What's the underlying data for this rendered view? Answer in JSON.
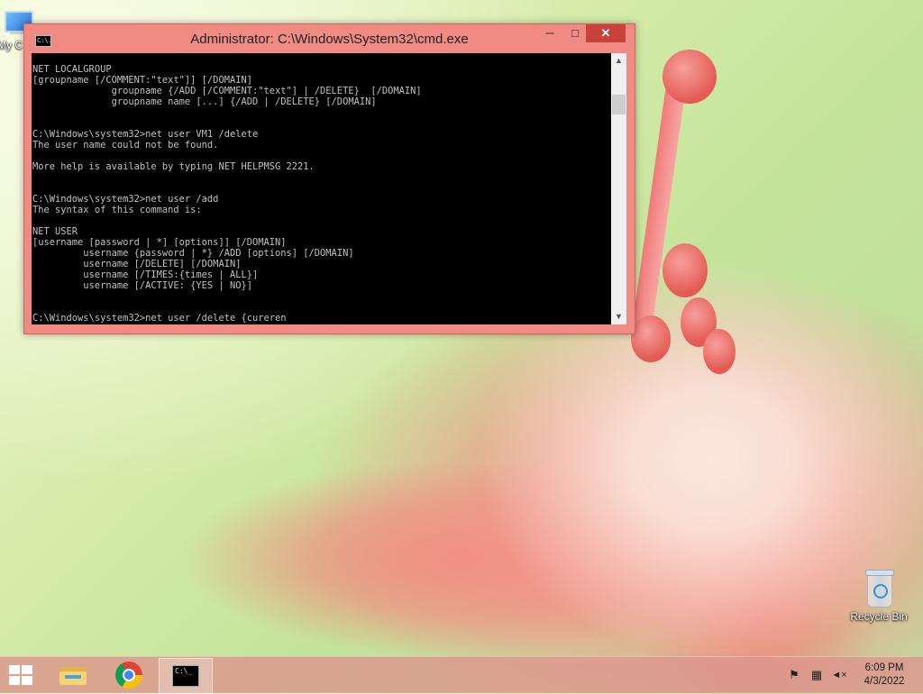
{
  "desktop": {
    "icons": [
      {
        "label": "My C"
      },
      {
        "label": "Recycle Bin"
      }
    ]
  },
  "window": {
    "title": "Administrator: C:\\Windows\\System32\\cmd.exe",
    "title_icon_text": "C:\\.",
    "minimize": "─",
    "maximize": "□",
    "close": "✕",
    "console_lines": [
      "NET LOCALGROUP",
      "[groupname [/COMMENT:\"text\"]] [/DOMAIN]",
      "              groupname {/ADD [/COMMENT:\"text\"] | /DELETE}  [/DOMAIN]",
      "              groupname name [...] {/ADD | /DELETE} [/DOMAIN]",
      "",
      "",
      "C:\\Windows\\system32>net user VM1 /delete",
      "The user name could not be found.",
      "",
      "More help is available by typing NET HELPMSG 2221.",
      "",
      "",
      "C:\\Windows\\system32>net user /add",
      "The syntax of this command is:",
      "",
      "NET USER",
      "[username [password | *] [options]] [/DOMAIN]",
      "         username {password | *} /ADD [options] [/DOMAIN]",
      "         username [/DELETE] [/DOMAIN]",
      "         username [/TIMES:{times | ALL}]",
      "         username [/ACTIVE: {YES | NO}]",
      "",
      "",
      "C:\\Windows\\system32>net user /delete {cureren"
    ],
    "scroll_up": "▲",
    "scroll_down": "▼"
  },
  "taskbar": {
    "cmd_icon_text": "C:\\_",
    "tray": {
      "flag_icon": "⚑",
      "network_icon": "▦",
      "volume_icon": "◄×"
    },
    "clock": {
      "time": "6:09 PM",
      "date": "4/3/2022"
    }
  },
  "colors": {
    "window_frame": "#f08b83",
    "close_button": "#c7423a",
    "console_bg": "#000000",
    "console_text": "#c0c0c0",
    "taskbar": "#dc968c"
  }
}
